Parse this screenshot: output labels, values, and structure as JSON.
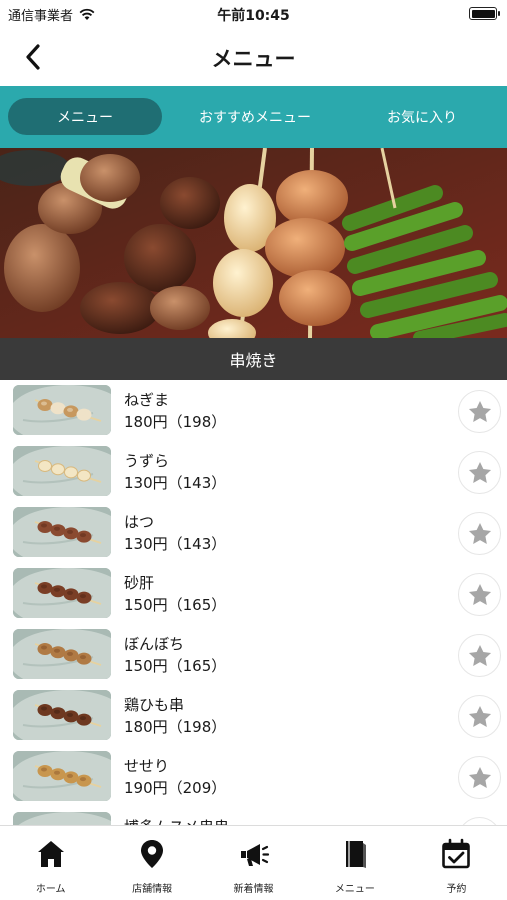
{
  "status_bar": {
    "carrier": "通信事業者",
    "time": "午前10:45"
  },
  "nav": {
    "title": "メニュー"
  },
  "tabs": [
    {
      "label": "メニュー",
      "active": true
    },
    {
      "label": "おすすめメニュー",
      "active": false
    },
    {
      "label": "お気に入り",
      "active": false
    }
  ],
  "category": {
    "title": "串焼き"
  },
  "items": [
    {
      "name": "ねぎま",
      "price": "180円（198）"
    },
    {
      "name": "うずら",
      "price": "130円（143）"
    },
    {
      "name": "はつ",
      "price": "130円（143）"
    },
    {
      "name": "砂肝",
      "price": "150円（165）"
    },
    {
      "name": "ぼんぼち",
      "price": "150円（165）"
    },
    {
      "name": "鶏ひも串",
      "price": "180円（198）"
    },
    {
      "name": "せせり",
      "price": "190円（209）"
    },
    {
      "name": "博多ムスメ串串",
      "price": ""
    }
  ],
  "tabbar": [
    {
      "label": "ホーム",
      "icon": "home-icon"
    },
    {
      "label": "店舗情報",
      "icon": "location-pin-icon"
    },
    {
      "label": "新着情報",
      "icon": "megaphone-icon"
    },
    {
      "label": "メニュー",
      "icon": "book-icon"
    },
    {
      "label": "予約",
      "icon": "calendar-check-icon"
    }
  ],
  "colors": {
    "accent": "#2ba9ad",
    "active_tab": "#1f6e73",
    "category_bar": "#3a3a3a",
    "star": "#a6a6a6"
  }
}
